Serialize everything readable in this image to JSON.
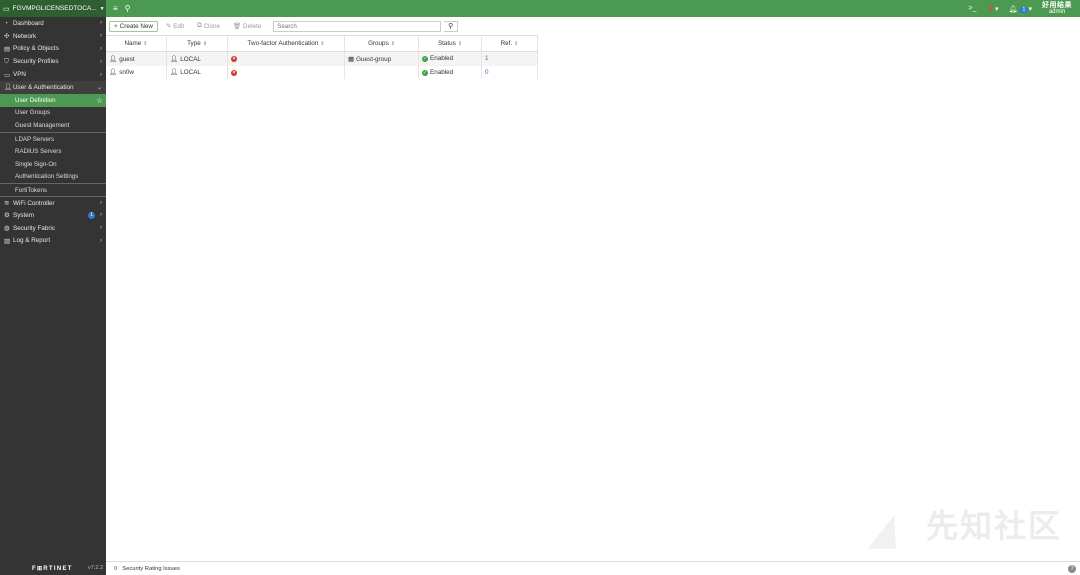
{
  "topbar": {
    "device_name": "FGVMPGLICENSEDTOCA...",
    "notification_count": "1",
    "admin_overlay": "好用结果",
    "admin_label": "admin"
  },
  "sidebar": {
    "items": [
      {
        "label": "Dashboard",
        "icon": "dashboard-icon"
      },
      {
        "label": "Network",
        "icon": "network-icon"
      },
      {
        "label": "Policy & Objects",
        "icon": "policy-icon"
      },
      {
        "label": "Security Profiles",
        "icon": "shield-icon"
      },
      {
        "label": "VPN",
        "icon": "vpn-icon"
      },
      {
        "label": "User & Authentication",
        "icon": "user-icon"
      }
    ],
    "sub_items": [
      "User Definition",
      "User Groups",
      "Guest Management",
      "LDAP Servers",
      "RADIUS Servers",
      "Single Sign-On",
      "Authentication Settings",
      "FortiTokens"
    ],
    "bottom_items": [
      {
        "label": "WiFi Controller",
        "icon": "wifi-icon"
      },
      {
        "label": "System",
        "icon": "gear-icon",
        "badge": "1"
      },
      {
        "label": "Security Fabric",
        "icon": "fabric-icon"
      },
      {
        "label": "Log & Report",
        "icon": "chart-icon"
      }
    ],
    "logo": "F⊞RTINET",
    "version": "v7.2.2"
  },
  "toolbar": {
    "create_label": "Create New",
    "edit_label": "Edit",
    "clone_label": "Clone",
    "delete_label": "Delete",
    "search_placeholder": "Search"
  },
  "table": {
    "headers": [
      "Name",
      "Type",
      "Two-factor Authentication",
      "Groups",
      "Status",
      "Ref."
    ],
    "rows": [
      {
        "name": "guest",
        "type": "LOCAL",
        "groups": "Guest-group",
        "status": "Enabled",
        "ref": "1"
      },
      {
        "name": "sn0w",
        "type": "LOCAL",
        "groups": "",
        "status": "Enabled",
        "ref": "0"
      }
    ]
  },
  "statusbar": {
    "count": "0",
    "label": "Security Rating Issues"
  },
  "watermark": "先知社区",
  "colors": {
    "accent": "#4c9a52",
    "sidebar_bg": "#343434",
    "link": "#2e73c4",
    "error": "#d9312b"
  }
}
